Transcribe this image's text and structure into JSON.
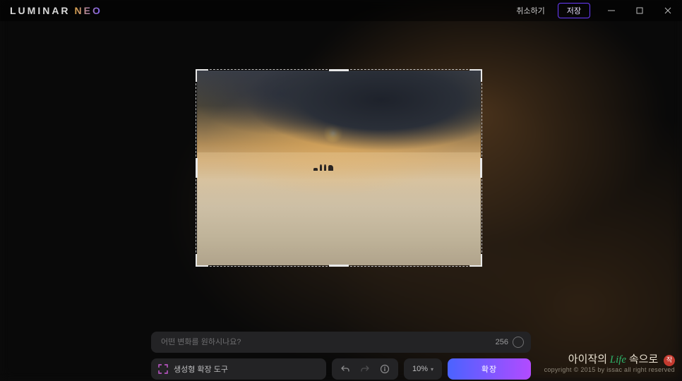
{
  "app": {
    "logo_main": "LUMINAR",
    "logo_sub": "NEO"
  },
  "header": {
    "cancel_label": "취소하기",
    "save_label": "저장"
  },
  "prompt": {
    "placeholder": "어떤 변화를 원하시나요?",
    "char_limit": "256"
  },
  "tool": {
    "name": "생성형 확장 도구",
    "zoom_label": "10%",
    "expand_label": "확장"
  },
  "watermark": {
    "line1_a": "아이작의 ",
    "line1_life": "Life",
    "line1_b": " 속으로",
    "seal": "작",
    "line2": "copyright © 2015 by issac all right reserved"
  }
}
